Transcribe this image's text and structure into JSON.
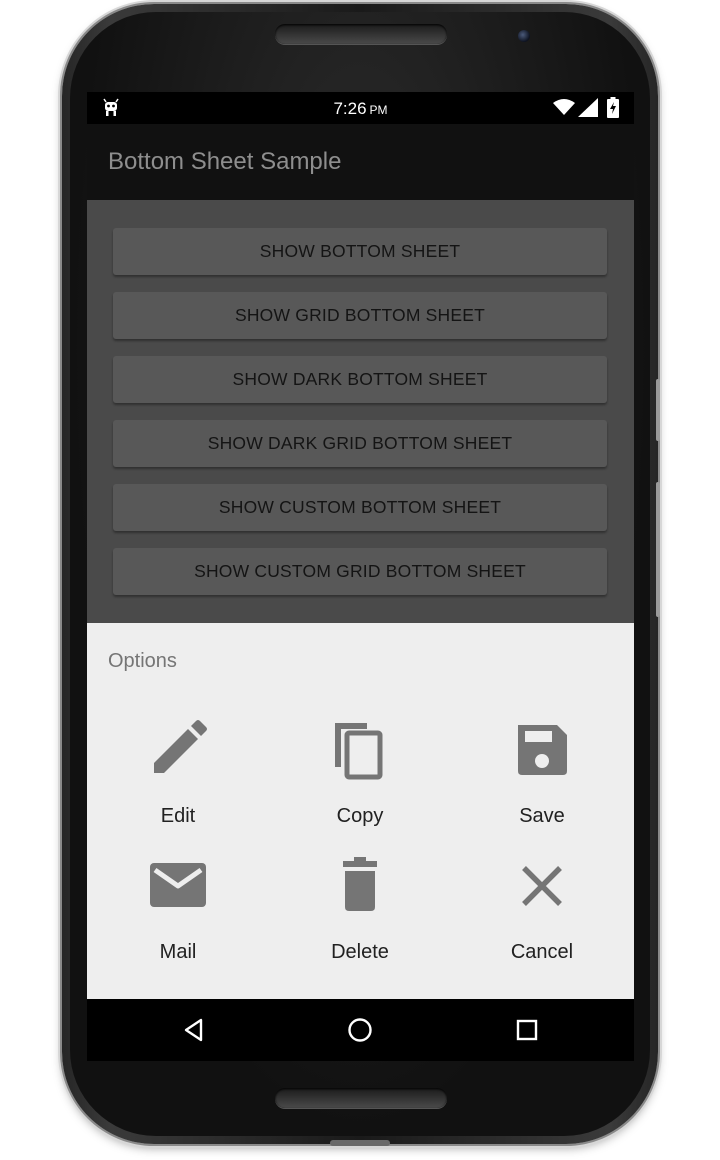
{
  "status_bar": {
    "time": "7:26",
    "ampm": "PM",
    "icons": [
      "android-icon",
      "wifi-icon",
      "signal-icon",
      "battery-charging-icon"
    ]
  },
  "app_bar": {
    "title": "Bottom Sheet Sample"
  },
  "buttons": [
    {
      "label": "SHOW BOTTOM SHEET"
    },
    {
      "label": "SHOW GRID BOTTOM SHEET"
    },
    {
      "label": "SHOW DARK BOTTOM SHEET"
    },
    {
      "label": "SHOW DARK GRID BOTTOM SHEET"
    },
    {
      "label": "SHOW CUSTOM BOTTOM SHEET"
    },
    {
      "label": "SHOW CUSTOM GRID BOTTOM SHEET"
    }
  ],
  "bottom_sheet": {
    "title": "Options",
    "items": [
      {
        "label": "Edit",
        "icon": "pencil-icon"
      },
      {
        "label": "Copy",
        "icon": "copy-icon"
      },
      {
        "label": "Save",
        "icon": "floppy-disk-icon"
      },
      {
        "label": "Mail",
        "icon": "envelope-icon"
      },
      {
        "label": "Delete",
        "icon": "trash-icon"
      },
      {
        "label": "Cancel",
        "icon": "close-icon"
      }
    ]
  },
  "nav_bar": {
    "icons": [
      "back-icon",
      "home-icon",
      "recents-icon"
    ]
  },
  "colors": {
    "scrim_content": "#4a4a4a",
    "button_bg": "#585858",
    "sheet_bg": "#eeeeee",
    "icon_grey": "#757575",
    "app_bar": "#111111"
  }
}
